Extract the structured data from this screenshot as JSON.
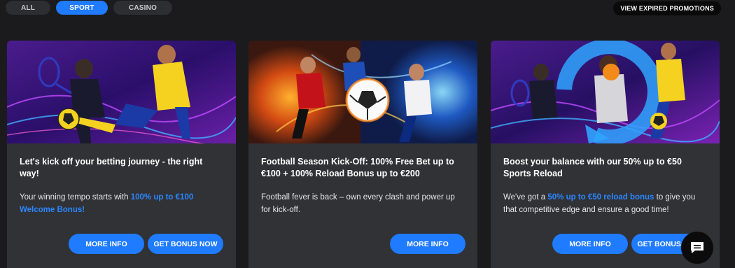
{
  "filters": [
    {
      "label": "ALL",
      "active": false
    },
    {
      "label": "SPORT",
      "active": true
    },
    {
      "label": "CASINO",
      "active": false
    }
  ],
  "expired_label": "VIEW EXPIRED PROMOTIONS",
  "cards": [
    {
      "title": "Let's kick off your betting journey - the right way!",
      "desc_pre": " Your winning tempo starts with ",
      "desc_highlight": "100% up to €100 Welcome Bonus!",
      "desc_post": "",
      "buttons": [
        "MORE INFO",
        "GET BONUS NOW"
      ]
    },
    {
      "title": "Football Season Kick-Off: 100% Free Bet up to €100 + 100% Reload Bonus up to €200",
      "desc_pre": "Football fever is back – own every clash and power up for kick-off.",
      "desc_highlight": "",
      "desc_post": "",
      "buttons": [
        "MORE INFO"
      ]
    },
    {
      "title": "Boost your balance with our 50% up to €50 Sports Reload",
      "desc_pre": "We've got a ",
      "desc_highlight": "50% up to €50 reload bonus",
      "desc_post": " to give you that competitive edge and ensure a good time!",
      "buttons": [
        "MORE INFO",
        "GET BONUS NOW"
      ]
    }
  ],
  "colors": {
    "accent": "#1f7bff",
    "background": "#1b1b1d",
    "card": "#313236",
    "highlight": "#2b86ff"
  },
  "icons": {
    "chat": "chat-bubble-icon"
  }
}
